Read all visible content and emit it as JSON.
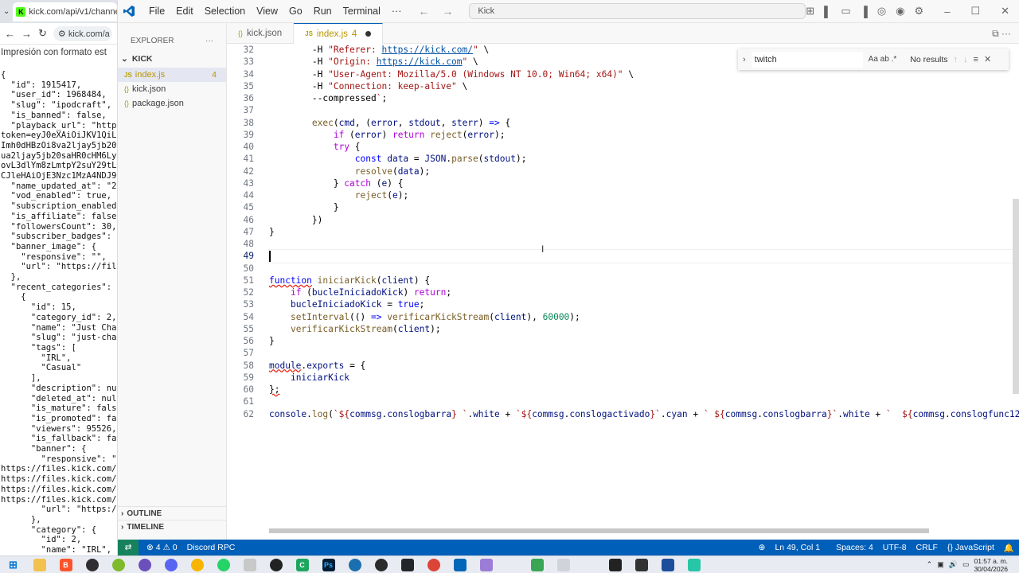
{
  "browser": {
    "tab_title": "kick.com/api/v1/channels/ip",
    "url": "kick.com/a",
    "pretty_label": "Impresión con formato est",
    "json_lines": [
      "{",
      "  \"id\": 1915417,",
      "  \"user_id\": 1968484,",
      "  \"slug\": \"ipodcraft\",",
      "  \"is_banned\": false,",
      "  \"playback_url\": \"https:",
      "token=eyJ0eXAiOiJKV1QiLCJ",
      "Imh0dHBzOi8va2ljay5jb20sa",
      "ua2ljay5jb20saHR0cHM6Ly9k",
      "ovL3dlYm8zLmtpY2suY29tLGh",
      "CJleHAiOjE3Nzc1MzA4NDJ9.Z",
      "  \"name_updated_at\": \"202",
      "  \"vod_enabled\": true,",
      "  \"subscription_enabled\":",
      "  \"is_affiliate\": false,",
      "  \"followersCount\": 30,",
      "  \"subscriber_badges\": []",
      "  \"banner_image\": {",
      "    \"responsive\": \"\",",
      "    \"url\": \"https://files",
      "  },",
      "  \"recent_categories\": [",
      "    {",
      "      \"id\": 15,",
      "      \"category_id\": 2,",
      "      \"name\": \"Just Chatt",
      "      \"slug\": \"just-chatt",
      "      \"tags\": [",
      "        \"IRL\",",
      "        \"Casual\"",
      "      ],",
      "      \"description\": null",
      "      \"deleted_at\": null,",
      "      \"is_mature\": false,",
      "      \"is_promoted\": fals",
      "      \"viewers\": 95526,",
      "      \"is_fallback\": fals",
      "      \"banner\": {",
      "        \"responsive\": \"ht",
      "https://files.kick.com/im",
      "https://files.kick.com/im",
      "https://files.kick.com/im",
      "https://files.kick.com/im",
      "        \"url\": \"https://f",
      "      },",
      "      \"category\": {",
      "        \"id\": 2,",
      "        \"name\": \"IRL\","
    ]
  },
  "vscode": {
    "menu": [
      "File",
      "Edit",
      "Selection",
      "View",
      "Go",
      "Run",
      "Terminal",
      "···"
    ],
    "command_center": "Kick",
    "explorer_title": "EXPLORER",
    "folder": "KICK",
    "files": [
      {
        "name": "index.js",
        "badge": "JS",
        "count": "4",
        "active": true
      },
      {
        "name": "kick.json",
        "badge": "{}",
        "count": "",
        "active": false
      },
      {
        "name": "package.json",
        "badge": "{}",
        "count": "",
        "active": false
      }
    ],
    "outline_label": "OUTLINE",
    "timeline_label": "TIMELINE",
    "tabs": [
      {
        "name": "kick.json",
        "badge": "{}"
      },
      {
        "name": "index.js",
        "badge": "JS",
        "count": "4"
      }
    ],
    "find": {
      "value": "twitch",
      "result": "No results",
      "opts": "Aa  ab  .*"
    },
    "line_numbers": [
      "32",
      "33",
      "34",
      "35",
      "36",
      "37",
      "38",
      "39",
      "40",
      "41",
      "42",
      "43",
      "44",
      "45",
      "46",
      "47",
      "48",
      "49",
      "50",
      "51",
      "52",
      "53",
      "54",
      "55",
      "56",
      "57",
      "58",
      "59",
      "60",
      "61",
      "62"
    ],
    "current_line": "49",
    "status": {
      "problems": "⊗ 4 ⚠ 0",
      "discord": "Discord RPC",
      "position": "Ln 49, Col 1",
      "spaces": "Spaces: 4",
      "encoding": "UTF-8",
      "eol": "CRLF",
      "language": "{} JavaScript"
    }
  },
  "taskbar": {
    "time": "01:57 a. m.",
    "date": "30/04/2026"
  }
}
